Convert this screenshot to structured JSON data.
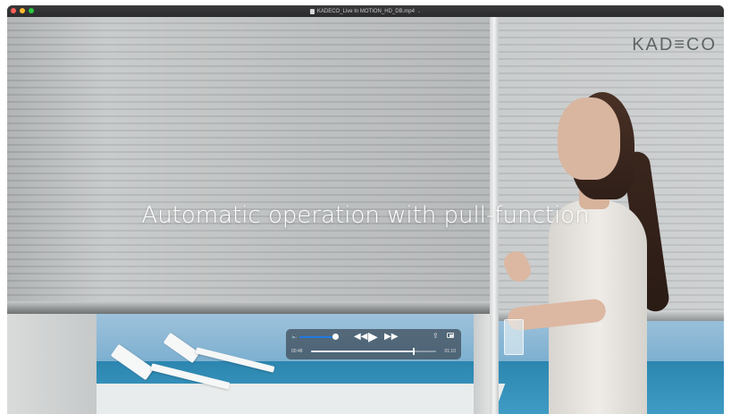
{
  "window": {
    "title": "KADECO_Live In MOTION_HD_DB.mp4",
    "title_chevron": "⌄",
    "traffic_lights": {
      "close": "#ff5f57",
      "minimize": "#febc2e",
      "maximize": "#28c840"
    }
  },
  "video": {
    "logo": "KAD≡CO",
    "caption": "Automatic operation with pull-function"
  },
  "player": {
    "volume_icon": "🔈",
    "volume_level": 0.9,
    "rewind_label": "◀◀",
    "play_label": "▶",
    "ffwd_label": "▶▶",
    "share_icon": "⇪",
    "pip_icon": "picture-in-picture-icon",
    "elapsed": "00:48",
    "remaining": "01:10",
    "progress": 0.82
  }
}
